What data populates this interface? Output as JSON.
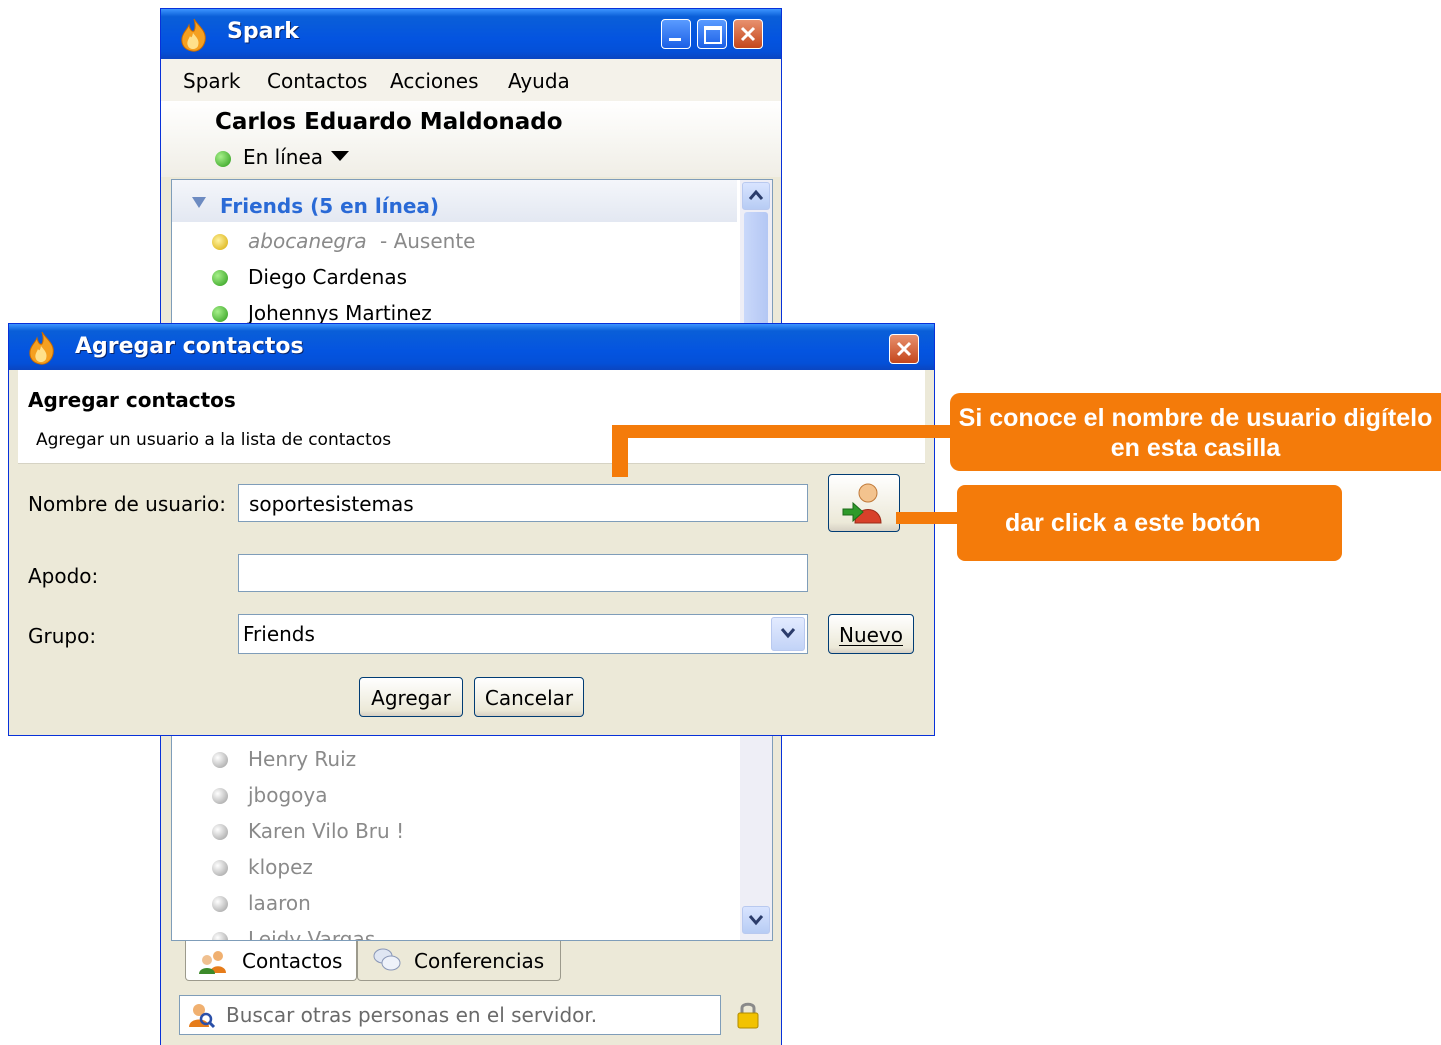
{
  "spark": {
    "title": "Spark",
    "menu": [
      "Spark",
      "Contactos",
      "Acciones",
      "Ayuda"
    ],
    "user_name": "Carlos Eduardo Maldonado",
    "status": "En línea",
    "group_label": "Friends (5 en línea)",
    "contacts_top": [
      {
        "name": "abocanegra",
        "status_text": "- Ausente",
        "state": "away"
      },
      {
        "name": "Diego Cardenas",
        "state": "online"
      },
      {
        "name": "Johennys Martinez",
        "state": "online"
      }
    ],
    "contacts_bottom": [
      {
        "name": "Henry Ruiz",
        "state": "offline"
      },
      {
        "name": "jbogoya",
        "state": "offline"
      },
      {
        "name": "Karen Vilo Bru !",
        "state": "offline"
      },
      {
        "name": "klopez",
        "state": "offline"
      },
      {
        "name": "laaron",
        "state": "offline"
      },
      {
        "name": "Leidy Vargas",
        "state": "offline"
      }
    ],
    "tabs": [
      "Contactos",
      "Conferencias"
    ],
    "search_placeholder": "Buscar otras personas en el servidor."
  },
  "dialog": {
    "title": "Agregar contactos",
    "heading": "Agregar contactos",
    "subheading": "Agregar un usuario a la lista de contactos",
    "username_label": "Nombre de usuario:",
    "username_value": "soportesistemas",
    "nickname_label": "Apodo:",
    "nickname_value": "",
    "group_label": "Grupo:",
    "group_value": "Friends",
    "new_button": "Nuevo",
    "add_button": "Agregar",
    "cancel_button": "Cancelar"
  },
  "annotations": {
    "callout1": "Si conoce el nombre de usuario digítelo en esta casilla",
    "callout2": "dar click a este botón"
  },
  "colors": {
    "title_bar": "#0454e0",
    "annotation": "#f47b0a",
    "group_label": "#2a6ad6"
  }
}
